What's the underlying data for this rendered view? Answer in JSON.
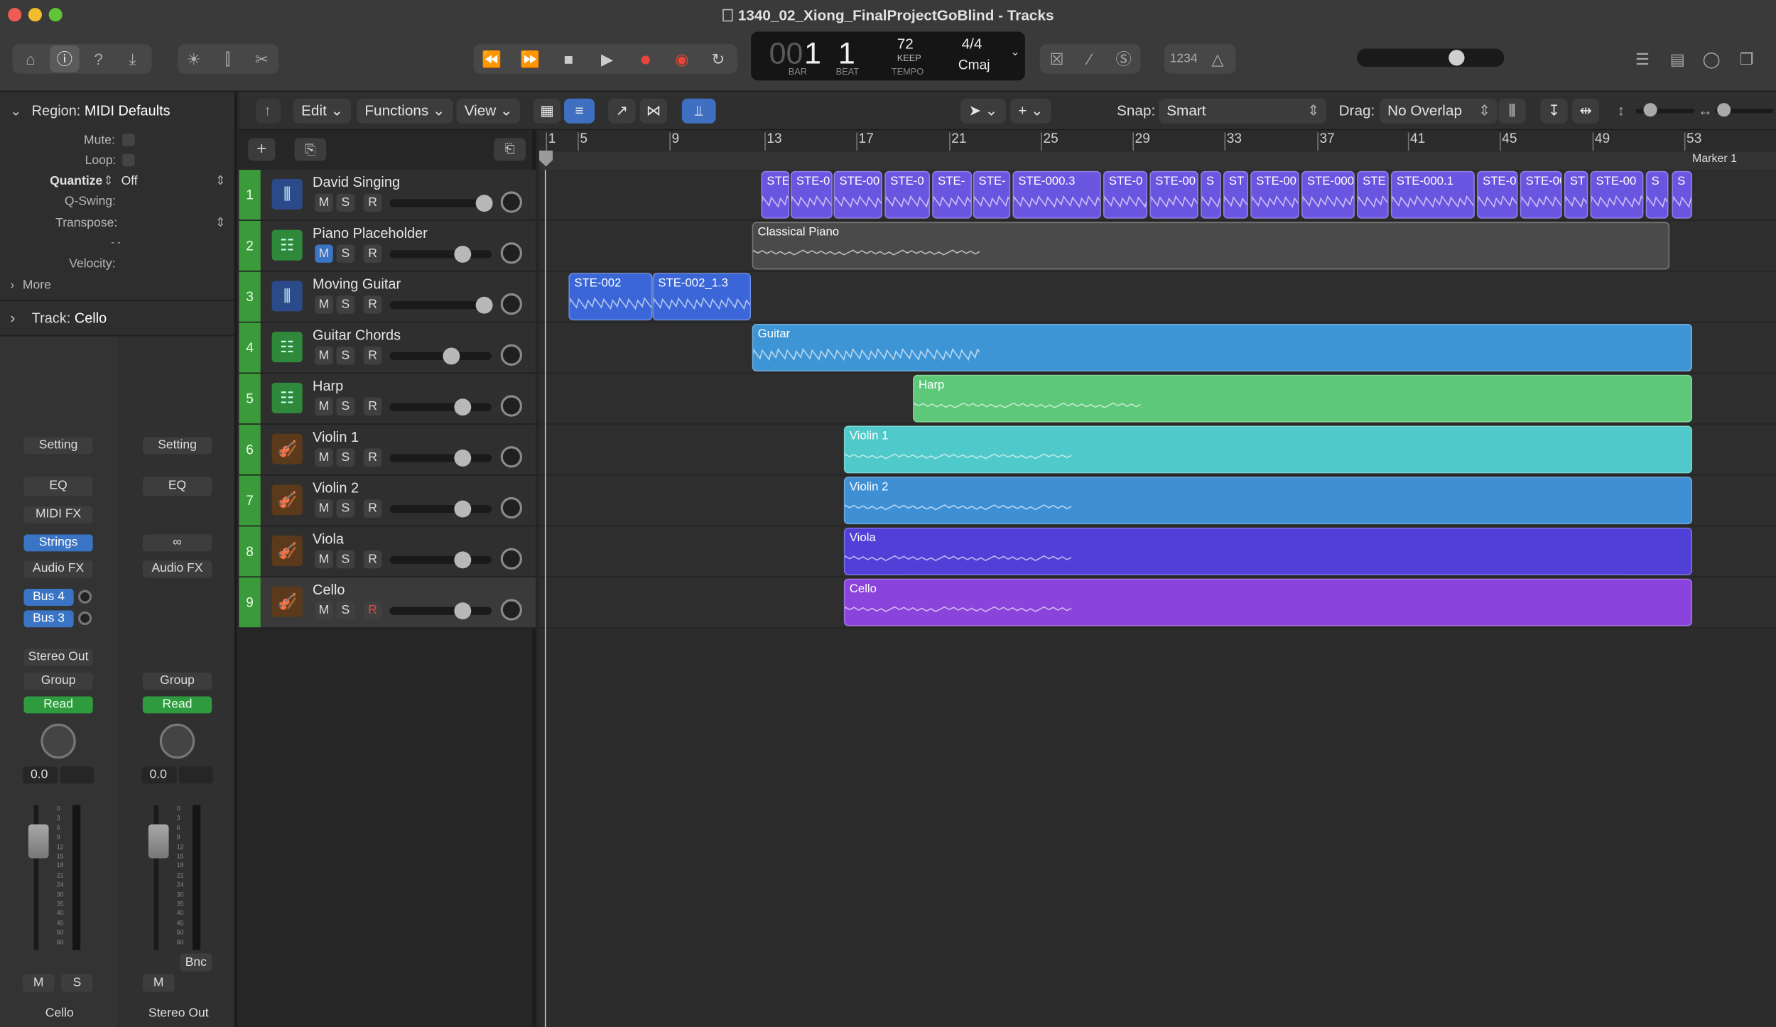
{
  "window": {
    "title": "1340_02_Xiong_FinalProjectGoBlind - Tracks"
  },
  "lcd": {
    "bar_dim": "00",
    "bar": "1",
    "beat": "1",
    "bar_label": "BAR",
    "beat_label": "BEAT",
    "tempo": "72",
    "keep": "KEEP",
    "tempo_label": "TEMPO",
    "signature": "4/4",
    "key": "Cmaj"
  },
  "toolbar": {
    "count_in": "1234"
  },
  "inspector": {
    "region_label": "Region:",
    "region_value": "MIDI Defaults",
    "mute": "Mute:",
    "loop": "Loop:",
    "quantize": "Quantize",
    "quantize_value": "Off",
    "qswing": "Q-Swing:",
    "transpose": "Transpose:",
    "dashes": "- -",
    "velocity": "Velocity:",
    "more": "More",
    "track_label": "Track:",
    "track_value": "Cello",
    "strip1": {
      "setting": "Setting",
      "eq": "EQ",
      "midifx": "MIDI FX",
      "instrument": "Strings",
      "audiofx": "Audio FX",
      "bus1": "Bus 4",
      "bus2": "Bus 3",
      "output": "Stereo Out",
      "group": "Group",
      "auto": "Read",
      "value": "0.0",
      "m": "M",
      "s": "S",
      "name": "Cello"
    },
    "strip2": {
      "setting": "Setting",
      "eq": "EQ",
      "audiofx": "Audio FX",
      "group": "Group",
      "auto": "Read",
      "value": "0.0",
      "m": "M",
      "bnc": "Bnc",
      "name": "Stereo Out"
    },
    "meter_scale": [
      "0",
      "3",
      "6",
      "9",
      "12",
      "15",
      "18",
      "21",
      "24",
      "30",
      "35",
      "40",
      "45",
      "50",
      "60"
    ]
  },
  "localbar": {
    "edit": "Edit",
    "functions": "Functions",
    "view": "View",
    "snap_label": "Snap:",
    "snap_value": "Smart",
    "drag_label": "Drag:",
    "drag_value": "No Overlap"
  },
  "ruler": {
    "bars": [
      "1",
      "5",
      "9",
      "13",
      "17",
      "21",
      "25",
      "29",
      "33",
      "37",
      "41",
      "45",
      "49",
      "53"
    ],
    "marker": "Marker 1"
  },
  "tracks": [
    {
      "num": "1",
      "name": "David Singing",
      "type": "audio"
    },
    {
      "num": "2",
      "name": "Piano Placeholder",
      "type": "midi"
    },
    {
      "num": "3",
      "name": "Moving Guitar",
      "type": "audio"
    },
    {
      "num": "4",
      "name": "Guitar Chords",
      "type": "midi"
    },
    {
      "num": "5",
      "name": "Harp",
      "type": "midi"
    },
    {
      "num": "6",
      "name": "Violin 1",
      "type": "strings"
    },
    {
      "num": "7",
      "name": "Violin 2",
      "type": "strings"
    },
    {
      "num": "8",
      "name": "Viola",
      "type": "strings"
    },
    {
      "num": "9",
      "name": "Cello",
      "type": "strings"
    }
  ],
  "buttons": {
    "m": "M",
    "s": "S",
    "r": "R"
  },
  "regions": {
    "singing": [
      "STE",
      "STE-0",
      "STE-00",
      "STE-0",
      "STE-",
      "STE-",
      "STE-000.3",
      "STE-0",
      "STE-00",
      "S",
      "ST",
      "STE-00",
      "STE-000",
      "STE",
      "STE-000.1",
      "STE-0",
      "STE-00",
      "ST",
      "STE-00",
      "S",
      "S"
    ],
    "piano": "Classical Piano",
    "moving": [
      "STE-002",
      "STE-002_1.3"
    ],
    "guitar": "Guitar",
    "harp": "Harp",
    "violin1": "Violin 1",
    "violin2": "Violin 2",
    "viola": "Viola",
    "cello": "Cello"
  },
  "colors": {
    "track_green": "#3b9b3b",
    "singing": "#6a55e0",
    "piano": "#4a4a4a",
    "moving": "#3a66d8",
    "guitar": "#3e95d6",
    "harp": "#5ec87a",
    "violin1": "#4fc9c9",
    "violin2": "#3f8fd4",
    "viola": "#5140d8",
    "cello": "#8a44dc"
  }
}
